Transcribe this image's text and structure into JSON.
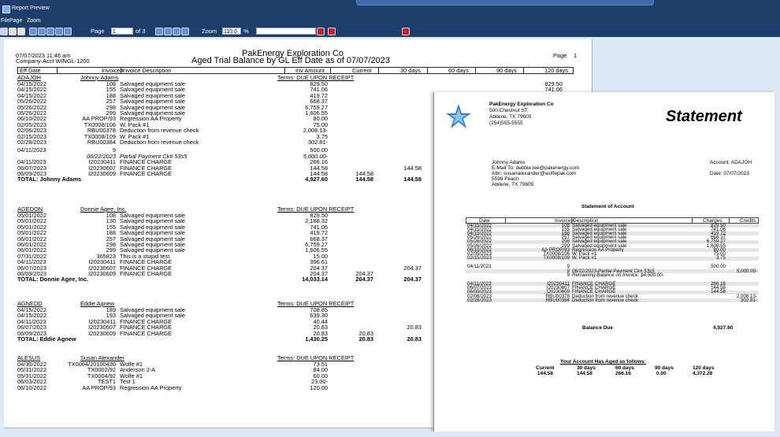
{
  "window": {
    "title": "Report Preview"
  },
  "menu": [
    "File",
    "Page",
    "Zoom"
  ],
  "toolbar": {
    "page_label": "Page",
    "page_value": "1",
    "of_label": "of 3",
    "zoom_label": "Zoom",
    "zoom_value": "110.0",
    "zoom_unit": "%"
  },
  "report": {
    "date_time": "07/07/2023 11:46 am",
    "company_acct": "Company-Acct WINGL-1200",
    "company_name": "PakEnergy Exploration Co",
    "title": "Aged Trial Balance by GL Eff Date as of 07/07/2023",
    "page_label": "Page",
    "page_number": "1",
    "columns": [
      "Eff Date",
      "Invoice#",
      "Invoice Description",
      "Inv Amount",
      "Current",
      "30 days",
      "60 days",
      "90 days",
      "120 days"
    ],
    "customers": [
      {
        "code": "ADAJOH",
        "name": "Johnny Adams",
        "terms": "Terms: DUE UPON RECEIPT",
        "rows": [
          {
            "date": "04/15/2022",
            "inv": "108",
            "desc": "Salvaged equipment sale",
            "amt": "829.50",
            "cur": "",
            "d30": "",
            "d120": "829.50"
          },
          {
            "date": "04/15/2022",
            "inv": "155",
            "desc": "Salvaged equipment sale",
            "amt": "741.06",
            "cur": "",
            "d30": "",
            "d120": "741.06"
          },
          {
            "date": "04/15/2022",
            "inv": "188",
            "desc": "Salvaged equipment sale",
            "amt": "419.72",
            "cur": "",
            "d30": "",
            "d120": ""
          },
          {
            "date": "05/26/2022",
            "inv": "257",
            "desc": "Salvaged equipment sale",
            "amt": "668.37",
            "cur": "",
            "d30": "",
            "d120": ""
          },
          {
            "date": "05/26/2022",
            "inv": "298",
            "desc": "Salvaged equipment sale",
            "amt": "6,759.27",
            "cur": "",
            "d30": "",
            "d120": ""
          },
          {
            "date": "05/26/2022",
            "inv": "299",
            "desc": "Salvaged equipment sale",
            "amt": "1,606.55",
            "cur": "",
            "d30": "",
            "d120": ""
          },
          {
            "date": "06/10/2022",
            "inv": "AA PROP/93",
            "desc": "Regression AA Property",
            "amt": "80.00",
            "cur": "",
            "d30": "",
            "d120": ""
          },
          {
            "date": "02/05/2023",
            "inv": "TX0008/106",
            "desc": "W. Pack #1",
            "amt": "75.00",
            "cur": "",
            "d30": "",
            "d120": ""
          },
          {
            "date": "02/06/2023",
            "inv": "RBU00378",
            "desc": "Deduction from revenue check",
            "amt": "2,008.13-",
            "cur": "",
            "d30": "",
            "d120": ""
          },
          {
            "date": "02/15/2023",
            "inv": "TX0008/109",
            "desc": "W. Pack #1",
            "amt": "3.75",
            "cur": "",
            "d30": "",
            "d120": ""
          },
          {
            "date": "02/28/2023",
            "inv": "RBU00384",
            "desc": "Deduction from revenue check",
            "amt": "302.81-",
            "cur": "",
            "d30": "",
            "d120": ""
          },
          {
            "date": "04/11/2023",
            "inv": "9",
            "desc": "",
            "amt": "500.00",
            "cur": "",
            "d30": "",
            "d120": "",
            "gap": true
          },
          {
            "date": "",
            "inv": "06/22/2023",
            "desc": "Partial Payment Ck# 53s5",
            "amt": "5,000.00-",
            "cur": "",
            "d30": "",
            "d120": "",
            "italic": true
          },
          {
            "date": "04/11/2023",
            "inv": "I20230411",
            "desc": "FINANCE CHARGE",
            "amt": "266.16",
            "cur": "",
            "d30": "",
            "d120": ""
          },
          {
            "date": "06/07/2023",
            "inv": "I20230607",
            "desc": "FINANCE CHARGE",
            "amt": "144.58",
            "cur": "",
            "d30": "144.58",
            "d120": ""
          },
          {
            "date": "06/09/2023",
            "inv": "I20230609",
            "desc": "FINANCE CHARGE",
            "amt": "144.58",
            "cur": "144.58",
            "d30": "",
            "d120": ""
          }
        ],
        "total": {
          "label": "TOTAL: Johnny Adams",
          "amt": "4,927.60",
          "cur": "144.58",
          "d30": "144.58"
        }
      },
      {
        "code": "AGEDON",
        "name": "Donnie Agee, Inc.",
        "terms": "Terms: DUE UPON RECEIPT",
        "rows": [
          {
            "date": "05/01/2022",
            "inv": "108",
            "desc": "Salvaged equipment sale",
            "amt": "829.50",
            "cur": "",
            "d30": "",
            "d120": ""
          },
          {
            "date": "05/01/2022",
            "inv": "130",
            "desc": "Salvaged equipment sale",
            "amt": "2,188.32",
            "cur": "",
            "d30": "",
            "d120": ""
          },
          {
            "date": "05/01/2022",
            "inv": "155",
            "desc": "Salvaged equipment sale",
            "amt": "741.06",
            "cur": "",
            "d30": "",
            "d120": ""
          },
          {
            "date": "05/01/2022",
            "inv": "188",
            "desc": "Salvaged equipment sale",
            "amt": "419.72",
            "cur": "",
            "d30": "",
            "d120": ""
          },
          {
            "date": "06/01/2022",
            "inv": "257",
            "desc": "Salvaged equipment sale",
            "amt": "668.37",
            "cur": "",
            "d30": "",
            "d120": ""
          },
          {
            "date": "06/01/2022",
            "inv": "298",
            "desc": "Salvaged equipment sale",
            "amt": "6,759.27",
            "cur": "",
            "d30": "",
            "d120": ""
          },
          {
            "date": "06/01/2022",
            "inv": "299",
            "desc": "Salvaged equipment sale",
            "amt": "1,606.55",
            "cur": "",
            "d30": "",
            "d120": ""
          },
          {
            "date": "07/31/2022",
            "inv": "365823",
            "desc": "This is a stupid test.",
            "amt": "15.00",
            "cur": "",
            "d30": "",
            "d120": ""
          },
          {
            "date": "04/11/2023",
            "inv": "I20230411",
            "desc": "FINANCE CHARGE",
            "amt": "396.61",
            "cur": "",
            "d30": "",
            "d120": ""
          },
          {
            "date": "06/07/2023",
            "inv": "I20230607",
            "desc": "FINANCE CHARGE",
            "amt": "204.37",
            "cur": "",
            "d30": "204.37",
            "d120": ""
          },
          {
            "date": "06/09/2023",
            "inv": "I20230609",
            "desc": "FINANCE CHARGE",
            "amt": "204.37",
            "cur": "204.37",
            "d30": "",
            "d120": ""
          }
        ],
        "total": {
          "label": "TOTAL: Donnie Agee, Inc.",
          "amt": "14,033.14",
          "cur": "204.37",
          "d30": "204.37"
        }
      },
      {
        "code": "AGNEDD",
        "name": "Eddie Agnew",
        "terms": "Terms: DUE UPON RECEIPT",
        "rows": [
          {
            "date": "04/15/2022",
            "inv": "189",
            "desc": "Salvaged equipment sale",
            "amt": "708.85",
            "cur": "",
            "d30": "",
            "d120": ""
          },
          {
            "date": "04/15/2022",
            "inv": "193",
            "desc": "Salvaged equipment sale",
            "amt": "639.30",
            "cur": "",
            "d30": "",
            "d120": ""
          },
          {
            "date": "04/11/2023",
            "inv": "I20230411",
            "desc": "FINANCE CHARGE",
            "amt": "40.44",
            "cur": "",
            "d30": "",
            "d120": ""
          },
          {
            "date": "06/07/2023",
            "inv": "I20230607",
            "desc": "FINANCE CHARGE",
            "amt": "20.83",
            "cur": "",
            "d30": "20.83",
            "d120": ""
          },
          {
            "date": "06/09/2023",
            "inv": "I20230609",
            "desc": "FINANCE CHARGE",
            "amt": "20.83",
            "cur": "20.83",
            "d30": "",
            "d120": ""
          }
        ],
        "total": {
          "label": "TOTAL: Eddie Agnew",
          "amt": "1,430.25",
          "cur": "20.83",
          "d30": "20.83"
        }
      },
      {
        "code": "ALESUS",
        "name": "Susan Alexander",
        "terms": "Terms: DUE UPON RECEIPT",
        "rows": [
          {
            "date": "04/30/2022",
            "inv": "TX0004/20100430",
            "desc": "Wolfe #1",
            "amt": "73.51",
            "cur": "",
            "d30": "",
            "d120": ""
          },
          {
            "date": "05/31/2022",
            "inv": "TX0002/92",
            "desc": "Anderson 2-A",
            "amt": "84.00",
            "cur": "",
            "d30": "",
            "d120": ""
          },
          {
            "date": "05/31/2022",
            "inv": "TX0004/92",
            "desc": "Wolfe #1",
            "amt": "60.00",
            "cur": "",
            "d30": "",
            "d120": ""
          },
          {
            "date": "06/03/2022",
            "inv": "TEST1",
            "desc": "Test 1",
            "amt": "23.00-",
            "cur": "",
            "d30": "",
            "d120": ""
          },
          {
            "date": "06/10/2022",
            "inv": "AA PROP/93",
            "desc": "Regression AA Property",
            "amt": "120.00",
            "cur": "",
            "d30": "",
            "d120": ""
          }
        ]
      }
    ]
  },
  "statement": {
    "company": {
      "name": "PakEnergy Exploration Co",
      "address1": "500 Chestnut ST.",
      "address2": "Abilene, TX 79605",
      "phone": "(254)555-5555"
    },
    "title": "Statement",
    "customer": {
      "name": "Johnny Adams",
      "email": "E-Mail To: debbie.lee@pakenergy.com",
      "attn": "Attn: susanalexander@wolfepak.com",
      "address1": "5598 Peach",
      "address2": "Abilene, TX 79605"
    },
    "account": "Account: ADAJOH",
    "date": "Date: 07/07/2023",
    "heading": "Statement of Account",
    "columns": [
      "Date",
      "Invoice#",
      "Description",
      "Charges",
      "Credits"
    ],
    "rows": [
      {
        "date": "04/15/2022",
        "inv": "108",
        "desc": "Salvaged equipment sale",
        "chg": "829.50",
        "cr": ""
      },
      {
        "date": "04/15/2022",
        "inv": "155",
        "desc": "Salvaged equipment sale",
        "chg": "741.06",
        "cr": ""
      },
      {
        "date": "04/15/2022",
        "inv": "188",
        "desc": "Salvaged equipment sale",
        "chg": "419.72",
        "cr": ""
      },
      {
        "date": "05/26/2022",
        "inv": "257",
        "desc": "Salvaged equipment sale",
        "chg": "668.37",
        "cr": ""
      },
      {
        "date": "05/26/2022",
        "inv": "298",
        "desc": "Salvaged equipment sale",
        "chg": "6,759.27",
        "cr": ""
      },
      {
        "date": "05/26/2022",
        "inv": "299",
        "desc": "Salvaged equipment sale",
        "chg": "1,606.55",
        "cr": ""
      },
      {
        "date": "06/10/2022",
        "inv": "AA PROP/93",
        "desc": "Regression AA Property",
        "chg": "80.00",
        "cr": ""
      },
      {
        "date": "02/05/2023",
        "inv": "TX0008/106",
        "desc": "W. Pack #1",
        "chg": "75.00",
        "cr": ""
      },
      {
        "date": "02/15/2023",
        "inv": "TX0008/109",
        "desc": "W. Pack #1",
        "chg": "3.75",
        "cr": ""
      },
      {
        "date": "04/11/2023",
        "inv": "9",
        "desc": "",
        "chg": "500.00",
        "cr": "",
        "gap": true
      },
      {
        "date": "",
        "inv": "9",
        "desc": "06/22/2023-Partial Payment Ck# 53s5",
        "chg": "",
        "cr": "5,000.00-",
        "italic": true
      },
      {
        "date": "",
        "inv": "9",
        "desc": "Remaining Balance on Invoice: $4,500.00-",
        "chg": "",
        "cr": "",
        "italic": true
      },
      {
        "date": "04/11/2023",
        "inv": "I20230411",
        "desc": "FINANCE CHARGE",
        "chg": "266.16",
        "cr": "",
        "gap": true
      },
      {
        "date": "06/07/2023",
        "inv": "I20230607",
        "desc": "FINANCE CHARGE",
        "chg": "144.58",
        "cr": ""
      },
      {
        "date": "06/09/2023",
        "inv": "I20230609",
        "desc": "FINANCE CHARGE",
        "chg": "144.58",
        "cr": ""
      },
      {
        "date": "02/06/2023",
        "inv": "RBU00378",
        "desc": "Deduction from revenue check",
        "chg": "",
        "cr": "2,008.13-"
      },
      {
        "date": "02/28/2023",
        "inv": "RBU00384",
        "desc": "Deduction from revenue check",
        "chg": "",
        "cr": "302.81-"
      }
    ],
    "balance_label": "Balance Due",
    "balance_value": "4,927.60",
    "aged_heading": "Your Account Has Aged as follows:",
    "aged_columns": [
      "Current",
      "30 days",
      "60 days",
      "90 days",
      "120 days"
    ],
    "aged_values": [
      "144.58",
      "144.58",
      "266.16",
      "0.00",
      "4,372.28"
    ]
  },
  "colors": {
    "chrome": "#1d3d6b",
    "stage": "#dfe9f5",
    "close_button": "#c0242a"
  }
}
